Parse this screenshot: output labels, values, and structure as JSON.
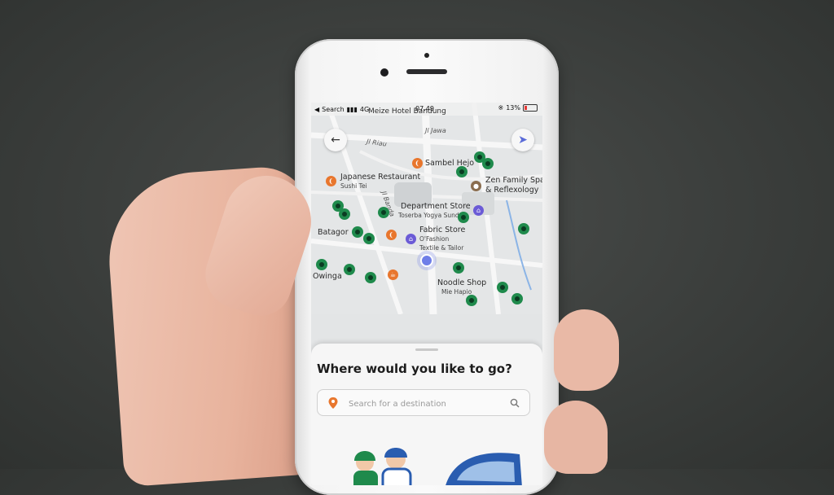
{
  "status_bar": {
    "back_label": "Search",
    "network": "4G",
    "time": "07.49",
    "battery": "13%"
  },
  "map": {
    "top_place": "Meize Hotel Bandung",
    "roads": [
      "Jl Jawa",
      "Jl Riau",
      "Jl Banda"
    ],
    "places": [
      {
        "name": "Sambel Hejo",
        "sub": "",
        "icon": "restaurant-icon"
      },
      {
        "name": "Japanese Restaurant",
        "sub": "Sushi Tei",
        "icon": "restaurant-icon"
      },
      {
        "name": "Zen Family Spa",
        "sub": "& Reflexology",
        "icon": "spa-icon"
      },
      {
        "name": "Department Store",
        "sub": "Toserba Yogya Sunda",
        "icon": "store-icon"
      },
      {
        "name": "Fabric Store",
        "sub": "O'Fashion",
        "sub2": "Textile & Tailor",
        "icon": "store-icon"
      },
      {
        "name": "Batagor",
        "sub": "",
        "icon": "restaurant-icon"
      },
      {
        "name": "Noodle Shop",
        "sub": "Mie Hapio",
        "icon": "restaurant-icon"
      },
      {
        "name": "Owinga",
        "sub": "",
        "icon": "restaurant-icon"
      }
    ]
  },
  "sheet": {
    "title": "Where would you like to go?",
    "search_placeholder": "Search for a destination"
  },
  "colors": {
    "accent_orange": "#e8762d",
    "accent_purple": "#6b5bd6",
    "driver_green": "#1f8a4c"
  }
}
